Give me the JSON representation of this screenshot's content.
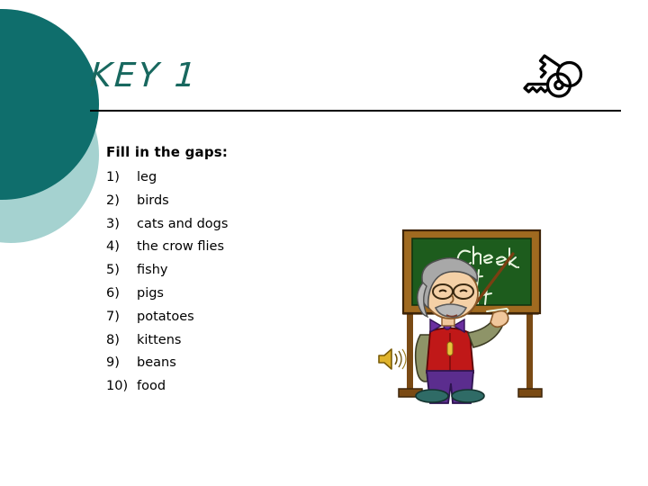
{
  "slide": {
    "title": "KEY 1",
    "title_color": "#18685f",
    "background_color": "#ffffff"
  },
  "decor": {
    "circle_dark_color": "#0f6e6c",
    "circle_light_color": "#a5d2d0",
    "keys_icon": "keys-icon"
  },
  "body": {
    "heading": "Fill in the gaps:",
    "answers": [
      {
        "num": "1)",
        "text": "leg"
      },
      {
        "num": "2)",
        "text": "birds"
      },
      {
        "num": "3)",
        "text": "cats and dogs"
      },
      {
        "num": "4)",
        "text": "the crow flies"
      },
      {
        "num": "5)",
        "text": "fishy"
      },
      {
        "num": "6)",
        "text": "pigs"
      },
      {
        "num": "7)",
        "text": "potatoes"
      },
      {
        "num": "8)",
        "text": "kittens"
      },
      {
        "num": "9)",
        "text": "beans"
      },
      {
        "num": "10)",
        "text": "food"
      }
    ]
  },
  "illustration": {
    "name": "teacher-at-chalkboard",
    "chalkboard_text_lines": [
      "Check",
      "it",
      "out!"
    ],
    "chalkboard_color": "#1d5c1d",
    "frame_color": "#a06a20",
    "vest_color": "#c01818",
    "trousers_color": "#5b2d8e",
    "jacket_color": "#8e9468",
    "bowtie_color": "#6b2fa0",
    "hair_color": "#a8a8a8",
    "shoe_color": "#2f6b66",
    "speaker_icon": "speaker-icon"
  }
}
